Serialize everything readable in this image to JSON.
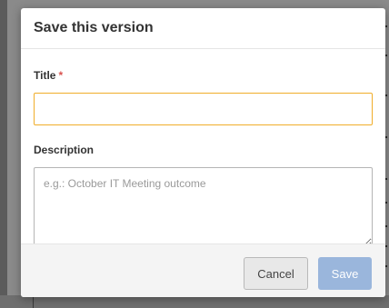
{
  "dialog": {
    "title": "Save this version",
    "fields": {
      "title_label": "Title",
      "required_marker": "*",
      "title_value": "",
      "description_label": "Description",
      "description_value": "",
      "description_placeholder": "e.g.: October IT Meeting outcome"
    },
    "buttons": {
      "cancel_label": "Cancel",
      "save_label": "Save"
    }
  },
  "colors": {
    "required_marker": "#d9534f",
    "title_input_focus_border": "#f0ad2a",
    "save_button_disabled": "#9ab6dc"
  }
}
